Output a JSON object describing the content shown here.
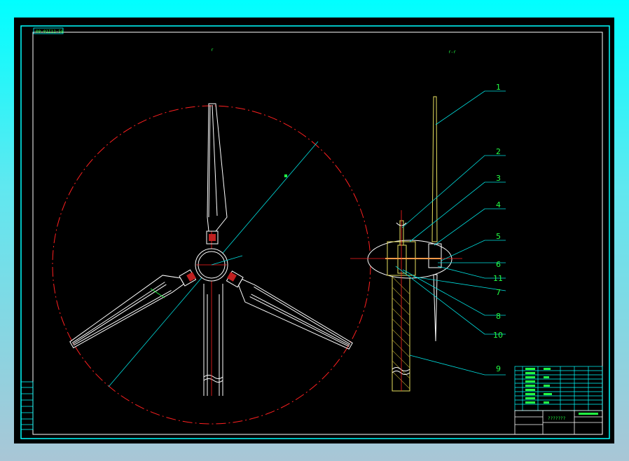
{
  "drawing": {
    "corner_tag": "00·01I11·58",
    "view_label_front": "r",
    "view_label_side": "r-r",
    "title_block_name": "???????",
    "colors": {
      "frame": "#00ffff",
      "outline": "#ffffff",
      "centerline": "#ff2020",
      "leader": "#00e0e0",
      "hatch": "#e8e060",
      "text": "#22ff44"
    },
    "callouts": [
      "1",
      "2",
      "3",
      "4",
      "5",
      "6",
      "11",
      "7",
      "8",
      "10",
      "9"
    ]
  }
}
